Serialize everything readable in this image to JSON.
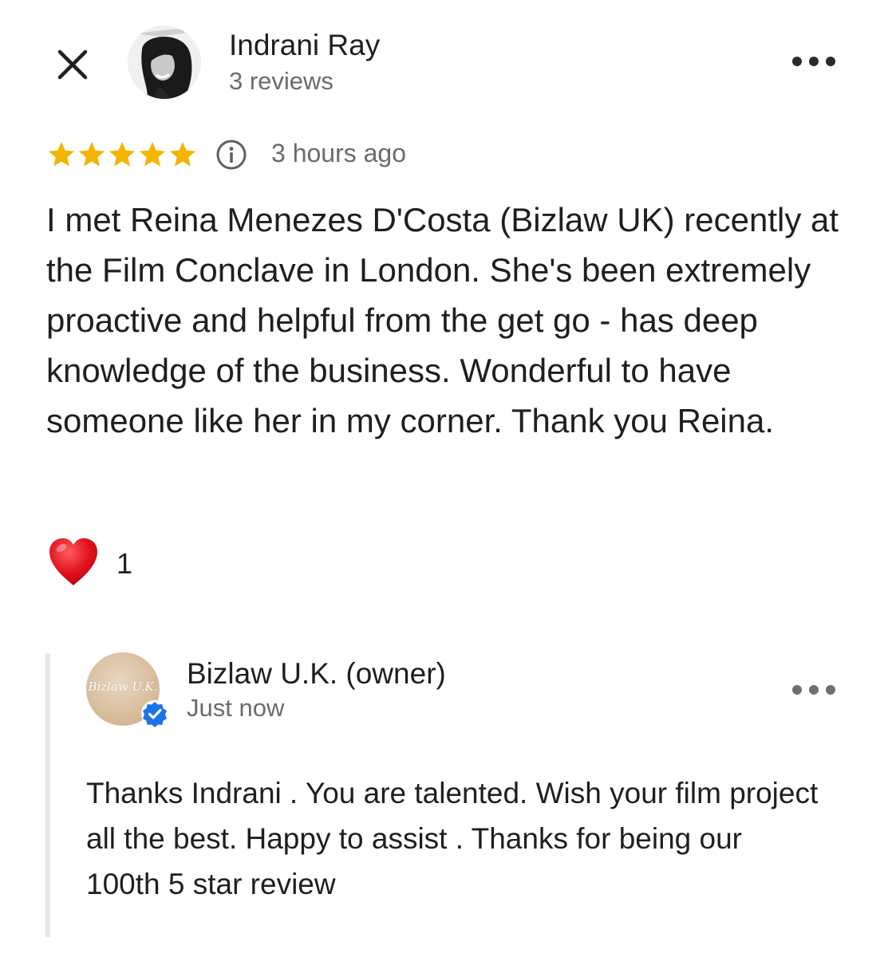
{
  "review": {
    "reviewer_name": "Indrani Ray",
    "reviewer_reviews": "3 reviews",
    "rating": 5,
    "rating_max": 5,
    "time_ago": "3 hours ago",
    "text": "I met Reina Menezes D'Costa (Bizlaw UK) recently at the Film Conclave in London. She's been extremely proactive and helpful from the get go - has deep knowledge of the business. Wonderful to have someone like her in my corner. Thank you Reina.",
    "reaction_count": "1"
  },
  "owner_reply": {
    "name": "Bizlaw U.K. (owner)",
    "logo_text": "Bizlaw U.K.",
    "time": "Just now",
    "text": "Thanks Indrani . You are talented. Wish your film project all the best. Happy to assist . Thanks for being our 100th 5 star review"
  },
  "icons": {
    "close": "close-icon",
    "more": "more-options-icon",
    "star": "star-icon",
    "info": "info-icon",
    "reaction": "heart-icon",
    "verified": "verified-badge-icon"
  },
  "colors": {
    "star": "#F4B400",
    "heart": "#E0101E",
    "verified": "#1A73E8",
    "secondary_text": "#6B6B6B",
    "reply_bar": "#E6E6E6"
  }
}
